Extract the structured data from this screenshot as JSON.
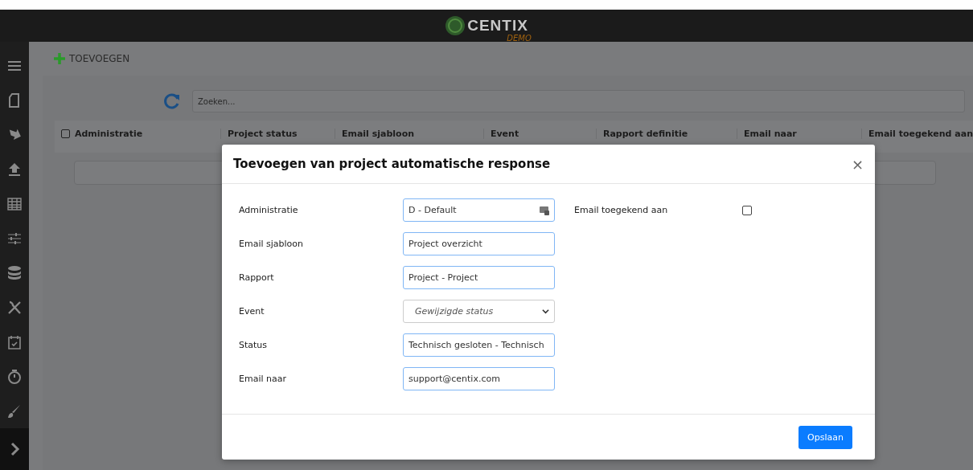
{
  "header": {
    "logo": "CENTIX",
    "logo_sub": "DEMO"
  },
  "toolbar": {
    "add_label": "TOEVOEGEN"
  },
  "search": {
    "placeholder": "Zoeken..."
  },
  "table": {
    "select_all_checked": false,
    "columns": [
      "Administratie",
      "Project status",
      "Email sjabloon",
      "Event",
      "Rapport definitie",
      "Email naar",
      "Email toegekend aan"
    ]
  },
  "dialog": {
    "title": "Toevoegen van project automatische response",
    "close": "×",
    "fields": [
      {
        "label": "Administratie",
        "kind": "lookup",
        "value": "D - Default"
      },
      {
        "label": "Email sjabloon",
        "kind": "text",
        "value": "Project overzicht"
      },
      {
        "label": "Rapport",
        "kind": "text",
        "value": "Project - Project"
      },
      {
        "label": "Event",
        "kind": "select",
        "value": "Gewijzigde status"
      },
      {
        "label": "Status",
        "kind": "text",
        "value": "Technisch gesloten - Technisch"
      },
      {
        "label": "Email naar",
        "kind": "text",
        "value": "support@centix.com"
      }
    ],
    "side_fields": [
      {
        "label": "Email toegekend aan",
        "kind": "checkbox",
        "checked": false
      }
    ],
    "buttons": [
      "Opslaan"
    ]
  }
}
